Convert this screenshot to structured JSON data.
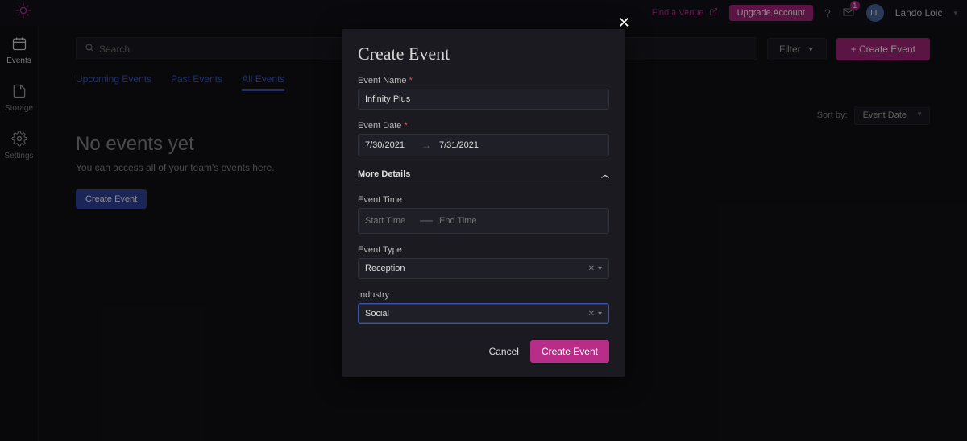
{
  "topbar": {
    "find_venue": "Find a Venue",
    "upgrade": "Upgrade Account",
    "notif_count": "1",
    "avatar_initials": "LL",
    "username": "Lando Loic"
  },
  "sidebar": {
    "items": [
      {
        "label": "Events"
      },
      {
        "label": "Storage"
      },
      {
        "label": "Settings"
      }
    ]
  },
  "toolbar": {
    "search_placeholder": "Search",
    "filter": "Filter",
    "create": "+ Create Event"
  },
  "tabs": [
    {
      "label": "Upcoming Events"
    },
    {
      "label": "Past Events"
    },
    {
      "label": "All Events",
      "active": true
    }
  ],
  "sort": {
    "label": "Sort by:",
    "value": "Event Date"
  },
  "empty": {
    "title": "No events yet",
    "subtitle": "You can access all of your team's events here.",
    "button": "Create Event"
  },
  "modal": {
    "title": "Create Event",
    "fields": {
      "name_label": "Event Name",
      "name_value": "Infinity Plus",
      "date_label": "Event Date",
      "date_start": "7/30/2021",
      "date_end": "7/31/2021",
      "more_details": "More Details",
      "time_label": "Event Time",
      "time_start_ph": "Start Time",
      "time_end_ph": "End Time",
      "type_label": "Event Type",
      "type_value": "Reception",
      "industry_label": "Industry",
      "industry_value": "Social"
    },
    "actions": {
      "cancel": "Cancel",
      "submit": "Create Event"
    }
  }
}
